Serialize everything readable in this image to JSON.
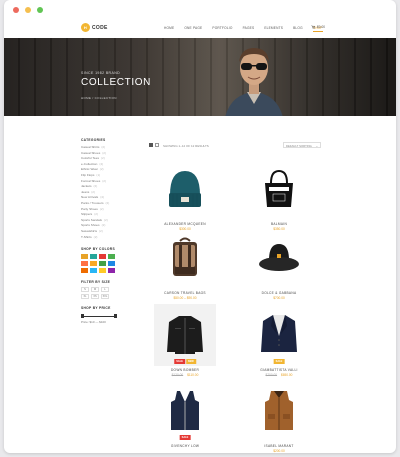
{
  "window": {
    "dot_colors": [
      "#ed6a5e",
      "#f5bf4f",
      "#61c554"
    ]
  },
  "nav": {
    "logo_letter": "H",
    "logo_rest": "CODE",
    "menu": [
      "HOME",
      "ONE PAGE",
      "PORTFOLIO",
      "PAGES",
      "ELEMENTS",
      "BLOG",
      "SHOP"
    ],
    "active_index": 6,
    "cart": "$0.00"
  },
  "hero": {
    "subtitle": "SINCE 1982 BRAND",
    "title": "COLLECTION",
    "breadcrumb": "HOME  /  COLLECTION"
  },
  "sidebar": {
    "categories_title": "CATEGORIES",
    "categories": [
      {
        "name": "Casual Shirts",
        "count": "(2)"
      },
      {
        "name": "Casual Shoes",
        "count": "(2)"
      },
      {
        "name": "Colorful Tees",
        "count": "(2)"
      },
      {
        "name": "e-Collection",
        "count": "(4)"
      },
      {
        "name": "Ethnic Wear",
        "count": "(2)"
      },
      {
        "name": "Flip Flops",
        "count": "(1)"
      },
      {
        "name": "Formal Shoes",
        "count": "(2)"
      },
      {
        "name": "Jackets",
        "count": "(2)"
      },
      {
        "name": "Jeans",
        "count": "(2)"
      },
      {
        "name": "New Arrivals",
        "count": "(4)"
      },
      {
        "name": "Pants / Trousers",
        "count": "(2)"
      },
      {
        "name": "Party Shoes",
        "count": "(2)"
      },
      {
        "name": "Slippers",
        "count": "(2)"
      },
      {
        "name": "Sports Sandals",
        "count": "(2)"
      },
      {
        "name": "Sports Shoes",
        "count": "(2)"
      },
      {
        "name": "Sweatshirts",
        "count": "(2)"
      },
      {
        "name": "T-Shirts",
        "count": "(2)"
      }
    ],
    "colors_title": "SHOP BY COLORS",
    "colors": [
      "#e8a328",
      "#26a69a",
      "#e53935",
      "#4caf50",
      "#ff7043",
      "#f9a825",
      "#43a047",
      "#1e88e5",
      "#ef6c00",
      "#29b6f6",
      "#ffca28",
      "#8e24aa"
    ],
    "size_title": "FILTER BY SIZE",
    "sizes": [
      "S",
      "M",
      "L",
      "XL",
      "XS",
      "XXL"
    ],
    "price_title": "SHOP BY PRICE",
    "price_label": "Price: $10 — $100"
  },
  "toolbar": {
    "showing": "SHOWING 1–12 OF 12 RESULTS",
    "sort": "DEFAULT SORTING"
  },
  "products": [
    {
      "name": "ALEXANDER MCQUEEN",
      "price": "$300.00",
      "old": ""
    },
    {
      "name": "BALMAIN",
      "price": "$350.00",
      "old": ""
    },
    {
      "name": "CARSON TRAVEL BAGS",
      "price": "$50.00 – $90.00",
      "old": ""
    },
    {
      "name": "DOLCE & GABBANA",
      "price": "$700.00",
      "old": ""
    },
    {
      "name": "DOWN BOMBER",
      "price": "$110.00",
      "old": "$120.00",
      "badges": [
        "SALE",
        "NEW"
      ]
    },
    {
      "name": "GIAMBATTISTA VALLI",
      "price": "$650.00",
      "old": "$700.00",
      "badges": [
        "SALE"
      ]
    },
    {
      "name": "GIVENCHY LOW",
      "price": "",
      "old": "",
      "badges": [
        "SALE"
      ]
    },
    {
      "name": "ISABEL MARANT",
      "price": "$200.00",
      "old": "",
      "badges": []
    }
  ]
}
